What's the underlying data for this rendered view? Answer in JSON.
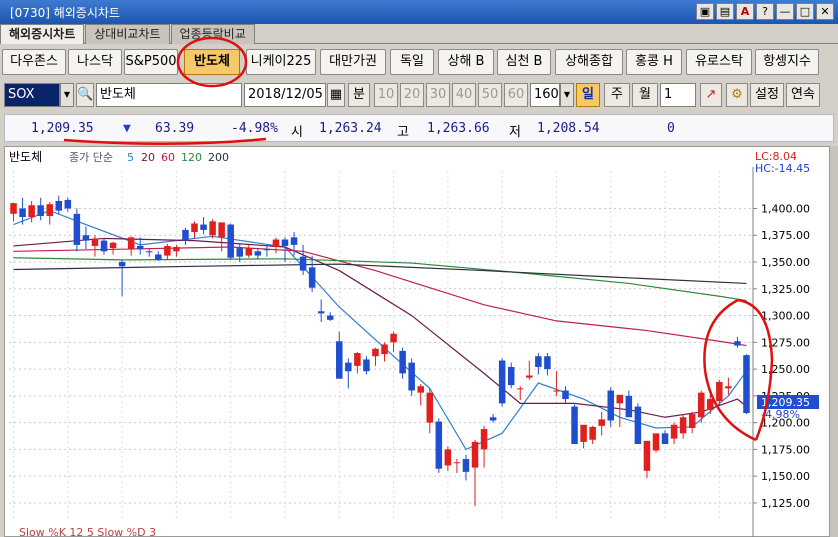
{
  "window": {
    "title": "[0730] 해외증시차트",
    "buttons": [
      "▣",
      "▤",
      "A",
      "?",
      "—",
      "□",
      "✕"
    ]
  },
  "tabs": [
    {
      "label": "해외증시차트",
      "active": true
    },
    {
      "label": "상대비교차트",
      "active": false
    },
    {
      "label": "업종등락비교",
      "active": false
    }
  ],
  "index_buttons": [
    {
      "label": "다우존스"
    },
    {
      "label": "나스닥"
    },
    {
      "label": "S&P500"
    },
    {
      "label": "반도체",
      "active": true
    },
    {
      "label": "니케이225"
    },
    {
      "label": "대만가권"
    },
    {
      "label": "독일"
    },
    {
      "label": "상해 B"
    },
    {
      "label": "심천 B"
    },
    {
      "label": "상해종합"
    },
    {
      "label": "홍콩 H"
    },
    {
      "label": "유로스탁"
    },
    {
      "label": "항셍지수"
    }
  ],
  "controls": {
    "symbol": "SOX",
    "name": "반도체",
    "date": "2018/12/05",
    "period_label": "분",
    "intervals": [
      "10",
      "20",
      "30",
      "40",
      "50",
      "60"
    ],
    "count": "160",
    "day": "일",
    "week": "주",
    "month": "월",
    "multiplier": "1",
    "settings": "설정",
    "continuous": "연속"
  },
  "quote": {
    "price": "1,209.35",
    "arrow": "▼",
    "change": "63.39",
    "change_pct": "-4.98%",
    "open_label": "시",
    "open": "1,263.24",
    "high_label": "고",
    "high": "1,263.66",
    "low_label": "저",
    "low": "1,208.54",
    "volume": "0"
  },
  "chart_header": {
    "name": "반도체",
    "series_label": "종가 단순",
    "ma_periods": [
      "5",
      "20",
      "60",
      "120",
      "200"
    ],
    "ma_colors": [
      "#2f7fd0",
      "#6a1b4d",
      "#c02050",
      "#2a8a3a",
      "#303040"
    ],
    "lc": "LC:8.04",
    "hc": "HC:-14.45",
    "last_price": "1,209.35",
    "last_pct": "-4.98%",
    "bottom_label": "Slow %K 12 5   Slow %D 3"
  },
  "chart_data": {
    "type": "candlestick",
    "ylim": [
      1110,
      1435
    ],
    "yticks": [
      1125,
      1150,
      1175,
      1200,
      1225,
      1250,
      1275,
      1300,
      1325,
      1350,
      1375,
      1400
    ],
    "ytick_labels": [
      "1,125.00",
      "1,150.00",
      "1,175.00",
      "1,200.00",
      "1,225.00",
      "1,250.00",
      "1,275.00",
      "1,300.00",
      "1,325.00",
      "1,350.00",
      "1,375.00",
      "1,400.00"
    ],
    "up_color": "#e0201e",
    "down_color": "#1f4fd0",
    "candles": [
      {
        "o": 1395,
        "h": 1405,
        "l": 1388,
        "c": 1405
      },
      {
        "o": 1400,
        "h": 1410,
        "l": 1385,
        "c": 1392
      },
      {
        "o": 1392,
        "h": 1407,
        "l": 1387,
        "c": 1403
      },
      {
        "o": 1403,
        "h": 1410,
        "l": 1389,
        "c": 1393
      },
      {
        "o": 1393,
        "h": 1406,
        "l": 1385,
        "c": 1404
      },
      {
        "o": 1407,
        "h": 1412,
        "l": 1395,
        "c": 1398
      },
      {
        "o": 1408,
        "h": 1410,
        "l": 1397,
        "c": 1400
      },
      {
        "o": 1395,
        "h": 1400,
        "l": 1360,
        "c": 1366
      },
      {
        "o": 1375,
        "h": 1383,
        "l": 1362,
        "c": 1370
      },
      {
        "o": 1365,
        "h": 1375,
        "l": 1355,
        "c": 1372
      },
      {
        "o": 1370,
        "h": 1372,
        "l": 1357,
        "c": 1360
      },
      {
        "o": 1363,
        "h": 1369,
        "l": 1357,
        "c": 1368
      },
      {
        "o": 1350,
        "h": 1352,
        "l": 1318,
        "c": 1346
      },
      {
        "o": 1362,
        "h": 1374,
        "l": 1356,
        "c": 1373
      },
      {
        "o": 1365,
        "h": 1373,
        "l": 1357,
        "c": 1362
      },
      {
        "o": 1360,
        "h": 1363,
        "l": 1355,
        "c": 1359
      },
      {
        "o": 1357,
        "h": 1360,
        "l": 1351,
        "c": 1352
      },
      {
        "o": 1356,
        "h": 1367,
        "l": 1352,
        "c": 1365
      },
      {
        "o": 1360,
        "h": 1366,
        "l": 1355,
        "c": 1364
      },
      {
        "o": 1380,
        "h": 1382,
        "l": 1366,
        "c": 1370
      },
      {
        "o": 1378,
        "h": 1388,
        "l": 1372,
        "c": 1386
      },
      {
        "o": 1385,
        "h": 1392,
        "l": 1376,
        "c": 1380
      },
      {
        "o": 1375,
        "h": 1390,
        "l": 1372,
        "c": 1388
      },
      {
        "o": 1373,
        "h": 1383,
        "l": 1360,
        "c": 1387
      },
      {
        "o": 1385,
        "h": 1386,
        "l": 1352,
        "c": 1354
      },
      {
        "o": 1363,
        "h": 1367,
        "l": 1350,
        "c": 1355
      },
      {
        "o": 1356,
        "h": 1366,
        "l": 1354,
        "c": 1363
      },
      {
        "o": 1360,
        "h": 1363,
        "l": 1353,
        "c": 1356
      },
      {
        "o": 1362,
        "h": 1365,
        "l": 1355,
        "c": 1361
      },
      {
        "o": 1364,
        "h": 1373,
        "l": 1358,
        "c": 1371
      },
      {
        "o": 1371,
        "h": 1373,
        "l": 1350,
        "c": 1365
      },
      {
        "o": 1373,
        "h": 1378,
        "l": 1356,
        "c": 1366
      },
      {
        "o": 1355,
        "h": 1366,
        "l": 1338,
        "c": 1342
      },
      {
        "o": 1345,
        "h": 1356,
        "l": 1322,
        "c": 1326
      },
      {
        "o": 1304,
        "h": 1315,
        "l": 1294,
        "c": 1302
      },
      {
        "o": 1300,
        "h": 1303,
        "l": 1295,
        "c": 1296
      },
      {
        "o": 1276,
        "h": 1285,
        "l": 1260,
        "c": 1241
      },
      {
        "o": 1256,
        "h": 1260,
        "l": 1232,
        "c": 1248
      },
      {
        "o": 1253,
        "h": 1266,
        "l": 1246,
        "c": 1265
      },
      {
        "o": 1259,
        "h": 1262,
        "l": 1245,
        "c": 1248
      },
      {
        "o": 1262,
        "h": 1270,
        "l": 1253,
        "c": 1269
      },
      {
        "o": 1264,
        "h": 1275,
        "l": 1257,
        "c": 1273
      },
      {
        "o": 1275,
        "h": 1285,
        "l": 1266,
        "c": 1283
      },
      {
        "o": 1267,
        "h": 1270,
        "l": 1241,
        "c": 1246
      },
      {
        "o": 1256,
        "h": 1260,
        "l": 1225,
        "c": 1230
      },
      {
        "o": 1228,
        "h": 1236,
        "l": 1216,
        "c": 1234
      },
      {
        "o": 1200,
        "h": 1232,
        "l": 1190,
        "c": 1228
      },
      {
        "o": 1201,
        "h": 1204,
        "l": 1153,
        "c": 1157
      },
      {
        "o": 1160,
        "h": 1178,
        "l": 1155,
        "c": 1175
      },
      {
        "o": 1163,
        "h": 1166,
        "l": 1153,
        "c": 1163
      },
      {
        "o": 1166,
        "h": 1170,
        "l": 1146,
        "c": 1154
      },
      {
        "o": 1158,
        "h": 1184,
        "l": 1122,
        "c": 1182
      },
      {
        "o": 1175,
        "h": 1197,
        "l": 1158,
        "c": 1194
      },
      {
        "o": 1205,
        "h": 1208,
        "l": 1200,
        "c": 1202
      },
      {
        "o": 1258,
        "h": 1260,
        "l": 1215,
        "c": 1218
      },
      {
        "o": 1252,
        "h": 1256,
        "l": 1232,
        "c": 1235
      },
      {
        "o": 1232,
        "h": 1234,
        "l": 1221,
        "c": 1232
      },
      {
        "o": 1242,
        "h": 1258,
        "l": 1240,
        "c": 1244
      },
      {
        "o": 1262,
        "h": 1265,
        "l": 1245,
        "c": 1252
      },
      {
        "o": 1262,
        "h": 1265,
        "l": 1244,
        "c": 1250
      },
      {
        "o": 1230,
        "h": 1248,
        "l": 1225,
        "c": 1230
      },
      {
        "o": 1230,
        "h": 1234,
        "l": 1218,
        "c": 1222
      },
      {
        "o": 1215,
        "h": 1217,
        "l": 1186,
        "c": 1180
      },
      {
        "o": 1182,
        "h": 1190,
        "l": 1176,
        "c": 1198
      },
      {
        "o": 1184,
        "h": 1197,
        "l": 1180,
        "c": 1196
      },
      {
        "o": 1197,
        "h": 1210,
        "l": 1188,
        "c": 1203
      },
      {
        "o": 1230,
        "h": 1233,
        "l": 1196,
        "c": 1202
      },
      {
        "o": 1218,
        "h": 1224,
        "l": 1196,
        "c": 1226
      },
      {
        "o": 1225,
        "h": 1230,
        "l": 1207,
        "c": 1205
      },
      {
        "o": 1215,
        "h": 1218,
        "l": 1186,
        "c": 1180
      },
      {
        "o": 1155,
        "h": 1180,
        "l": 1148,
        "c": 1183
      },
      {
        "o": 1174,
        "h": 1180,
        "l": 1172,
        "c": 1190
      },
      {
        "o": 1190,
        "h": 1193,
        "l": 1180,
        "c": 1180
      },
      {
        "o": 1185,
        "h": 1200,
        "l": 1180,
        "c": 1198
      },
      {
        "o": 1190,
        "h": 1208,
        "l": 1185,
        "c": 1205
      },
      {
        "o": 1195,
        "h": 1210,
        "l": 1190,
        "c": 1208
      },
      {
        "o": 1205,
        "h": 1230,
        "l": 1200,
        "c": 1228
      },
      {
        "o": 1212,
        "h": 1226,
        "l": 1208,
        "c": 1222
      },
      {
        "o": 1220,
        "h": 1240,
        "l": 1216,
        "c": 1238
      },
      {
        "o": 1232,
        "h": 1242,
        "l": 1226,
        "c": 1234
      },
      {
        "o": 1276,
        "h": 1280,
        "l": 1270,
        "c": 1272
      },
      {
        "o": 1263,
        "h": 1264,
        "l": 1208,
        "c": 1209
      }
    ],
    "ma_lines": [
      {
        "period": "5",
        "color": "#2f7fd0",
        "points": [
          [
            0,
            1385
          ],
          [
            4,
            1398
          ],
          [
            8,
            1385
          ],
          [
            14,
            1366
          ],
          [
            22,
            1374
          ],
          [
            30,
            1364
          ],
          [
            36,
            1308
          ],
          [
            42,
            1262
          ],
          [
            46,
            1232
          ],
          [
            50,
            1175
          ],
          [
            54,
            1190
          ],
          [
            58,
            1237
          ],
          [
            63,
            1222
          ],
          [
            67,
            1205
          ],
          [
            71,
            1195
          ],
          [
            75,
            1196
          ],
          [
            79,
            1225
          ],
          [
            81,
            1248
          ]
        ]
      },
      {
        "period": "20",
        "color": "#6a1b4d",
        "points": [
          [
            0,
            1365
          ],
          [
            10,
            1372
          ],
          [
            20,
            1370
          ],
          [
            30,
            1364
          ],
          [
            36,
            1342
          ],
          [
            44,
            1300
          ],
          [
            52,
            1246
          ],
          [
            56,
            1218
          ],
          [
            62,
            1218
          ],
          [
            68,
            1212
          ],
          [
            72,
            1205
          ],
          [
            76,
            1210
          ],
          [
            80,
            1222
          ],
          [
            81,
            1215
          ]
        ]
      },
      {
        "period": "60",
        "color": "#c02050",
        "points": [
          [
            0,
            1360
          ],
          [
            12,
            1362
          ],
          [
            24,
            1364
          ],
          [
            32,
            1360
          ],
          [
            40,
            1342
          ],
          [
            52,
            1310
          ],
          [
            60,
            1295
          ],
          [
            70,
            1286
          ],
          [
            78,
            1276
          ],
          [
            81,
            1272
          ]
        ]
      },
      {
        "period": "120",
        "color": "#2a8a3a",
        "points": [
          [
            0,
            1354
          ],
          [
            12,
            1352
          ],
          [
            30,
            1353
          ],
          [
            44,
            1349
          ],
          [
            56,
            1340
          ],
          [
            68,
            1330
          ],
          [
            78,
            1318
          ],
          [
            81,
            1314
          ]
        ]
      },
      {
        "period": "200",
        "color": "#303040",
        "points": [
          [
            0,
            1343
          ],
          [
            20,
            1346
          ],
          [
            36,
            1348
          ],
          [
            52,
            1342
          ],
          [
            66,
            1336
          ],
          [
            81,
            1330
          ]
        ]
      }
    ]
  }
}
